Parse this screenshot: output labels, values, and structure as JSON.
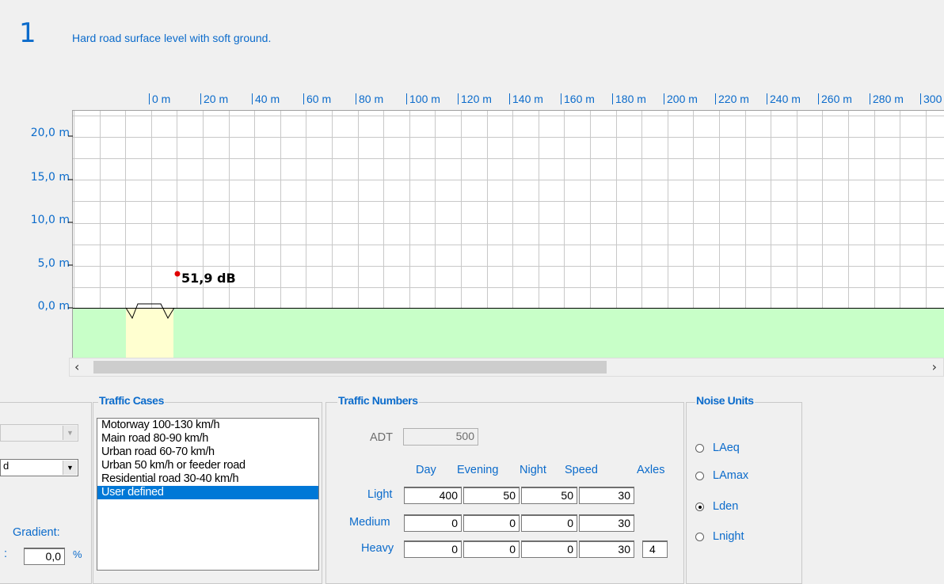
{
  "header": {
    "case_number": "1",
    "description": "Hard road surface level with soft ground."
  },
  "ruler": [
    "0 m",
    "20 m",
    "40 m",
    "60 m",
    "80 m",
    "100 m",
    "120 m",
    "140 m",
    "160 m",
    "180 m",
    "200 m",
    "220 m",
    "240 m",
    "260 m",
    "280 m",
    "300"
  ],
  "y_axis": [
    "20,0 m",
    "15,0 m",
    "10,0 m",
    "5,0 m",
    "0,0 m"
  ],
  "receiver": {
    "label": "51,9 dB",
    "color": "#e00000"
  },
  "colors": {
    "ground": "#c8ffc8",
    "road": "#ffffd0",
    "accent": "#0b6bcb",
    "selection": "#0078d7"
  },
  "left_panel": {
    "combo1_value": "",
    "combo2_value": "d",
    "gradient_label": "Gradient:",
    "gradient_prefix": ":",
    "gradient_value": "0,0",
    "gradient_unit": "%"
  },
  "traffic_cases": {
    "title": "Traffic Cases",
    "items": [
      "Motorway 100-130 km/h",
      "Main road 80-90 km/h",
      "Urban road 60-70 km/h",
      "Urban 50 km/h or feeder road",
      "Residential road 30-40 km/h",
      "User defined"
    ],
    "selected_index": 5
  },
  "traffic_numbers": {
    "title": "Traffic Numbers",
    "adt_label": "ADT",
    "adt_value": "500",
    "columns": [
      "Day",
      "Evening",
      "Night",
      "Speed",
      "Axles"
    ],
    "rows": [
      {
        "label": "Light",
        "day": "400",
        "evening": "50",
        "night": "50",
        "speed": "30"
      },
      {
        "label": "Medium",
        "day": "0",
        "evening": "0",
        "night": "0",
        "speed": "30"
      },
      {
        "label": "Heavy",
        "day": "0",
        "evening": "0",
        "night": "0",
        "speed": "30",
        "axles": "4"
      }
    ]
  },
  "noise_units": {
    "title": "Noise Units",
    "options": [
      "LAeq",
      "LAmax",
      "Lden",
      "Lnight"
    ],
    "selected": "Lden"
  }
}
